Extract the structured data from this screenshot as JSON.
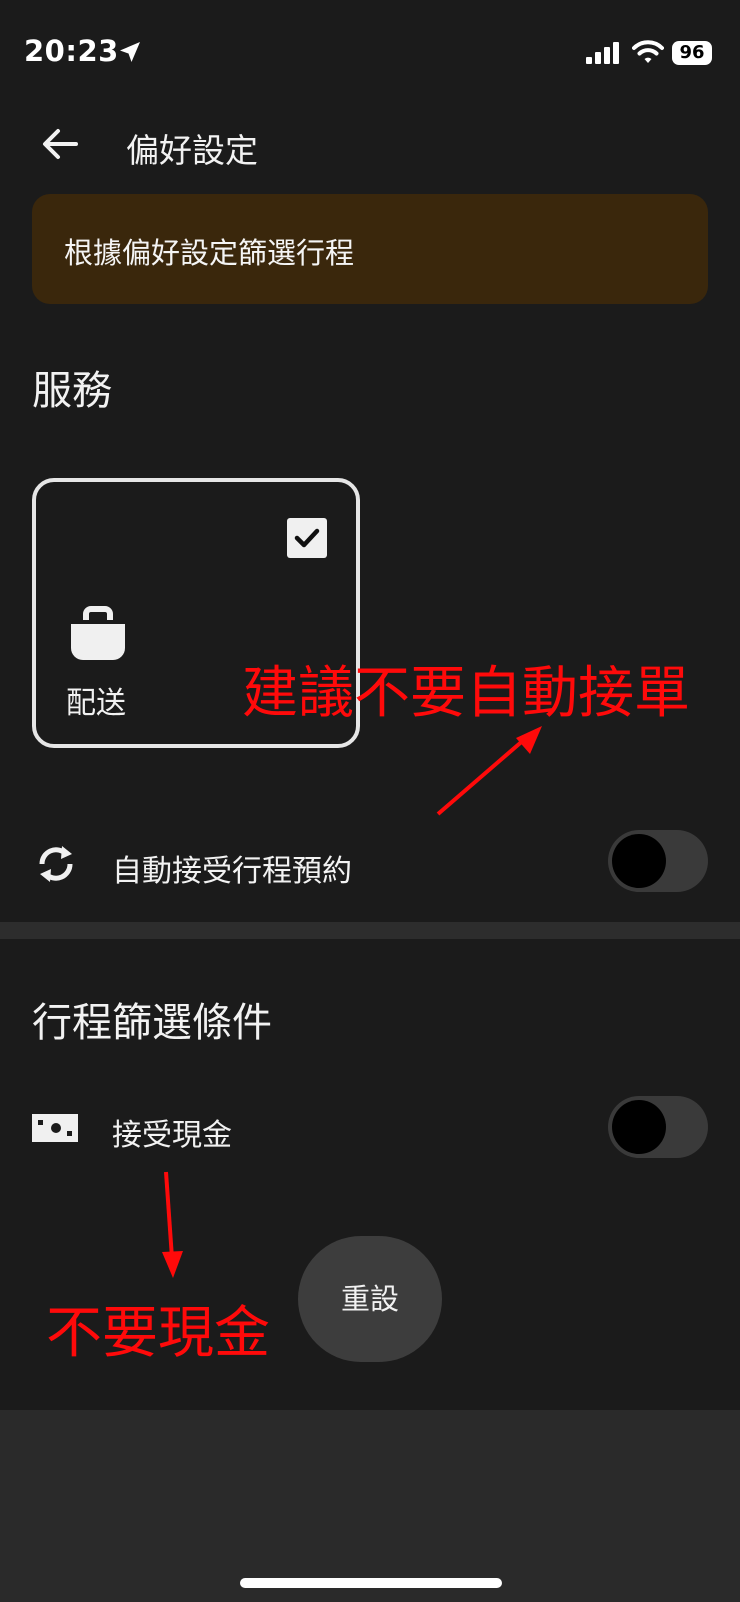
{
  "status_bar": {
    "time": "20:23",
    "battery": "96"
  },
  "header": {
    "title": "偏好設定"
  },
  "banner": {
    "text": "根據偏好設定篩選行程"
  },
  "services": {
    "title": "服務",
    "cards": [
      {
        "label": "配送",
        "checked": true,
        "icon": "shopping-bag-icon"
      }
    ]
  },
  "auto_accept": {
    "label": "自動接受行程預約",
    "enabled": false,
    "icon": "sync-icon"
  },
  "filters": {
    "title": "行程篩選條件",
    "cash": {
      "label": "接受現金",
      "enabled": false,
      "icon": "cash-icon"
    }
  },
  "reset_label": "重設",
  "annotations": [
    "建議不要自動接單",
    "不要現金"
  ],
  "colors": {
    "banner_bg": "#3a270c",
    "annotation": "#ff0a0a",
    "background": "#1b1b1b"
  }
}
